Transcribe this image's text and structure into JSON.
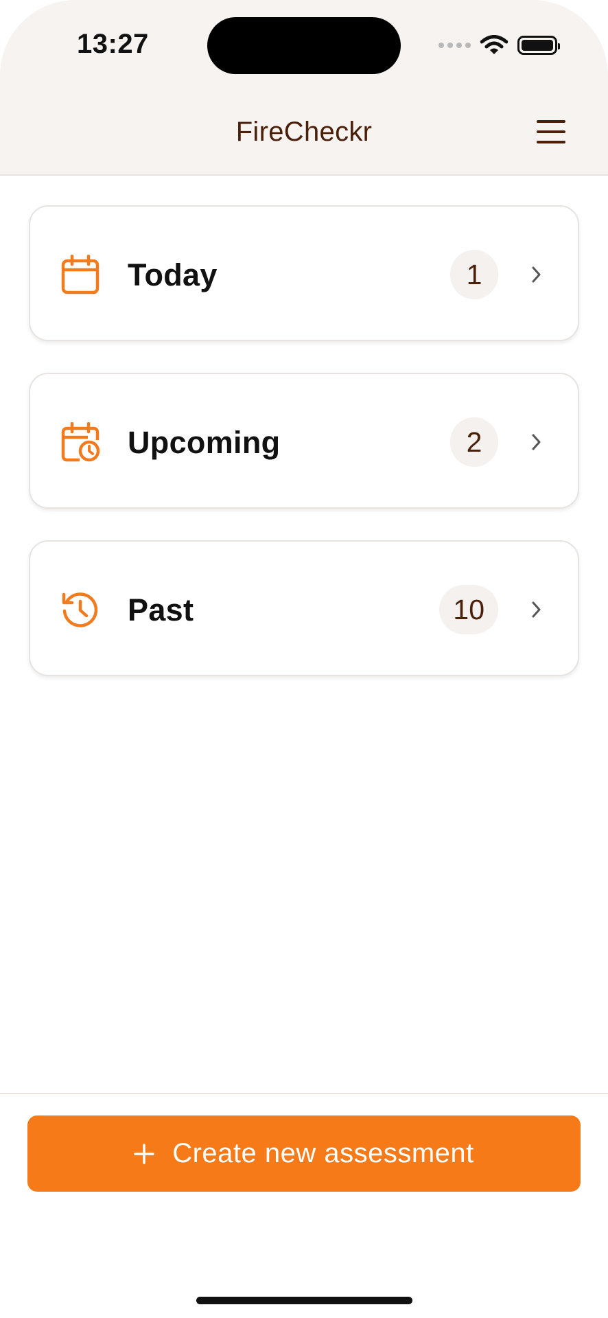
{
  "status_bar": {
    "time": "13:27",
    "icons": [
      "signal-icon",
      "wifi-icon",
      "battery-icon"
    ]
  },
  "header": {
    "title": "FireCheckr",
    "menu_icon": "hamburger-menu-icon"
  },
  "categories": [
    {
      "icon": "calendar-icon",
      "label": "Today",
      "count": "1"
    },
    {
      "icon": "calendar-clock-icon",
      "label": "Upcoming",
      "count": "2"
    },
    {
      "icon": "history-icon",
      "label": "Past",
      "count": "10"
    }
  ],
  "footer": {
    "create_button_label": "Create new assessment",
    "create_button_icon": "plus-icon"
  },
  "colors": {
    "accent": "#f77a18",
    "header_bg": "#f7f3f1",
    "title_text": "#4a200b",
    "badge_bg": "#f4f1ef",
    "icon_orange": "#f07c1f"
  }
}
